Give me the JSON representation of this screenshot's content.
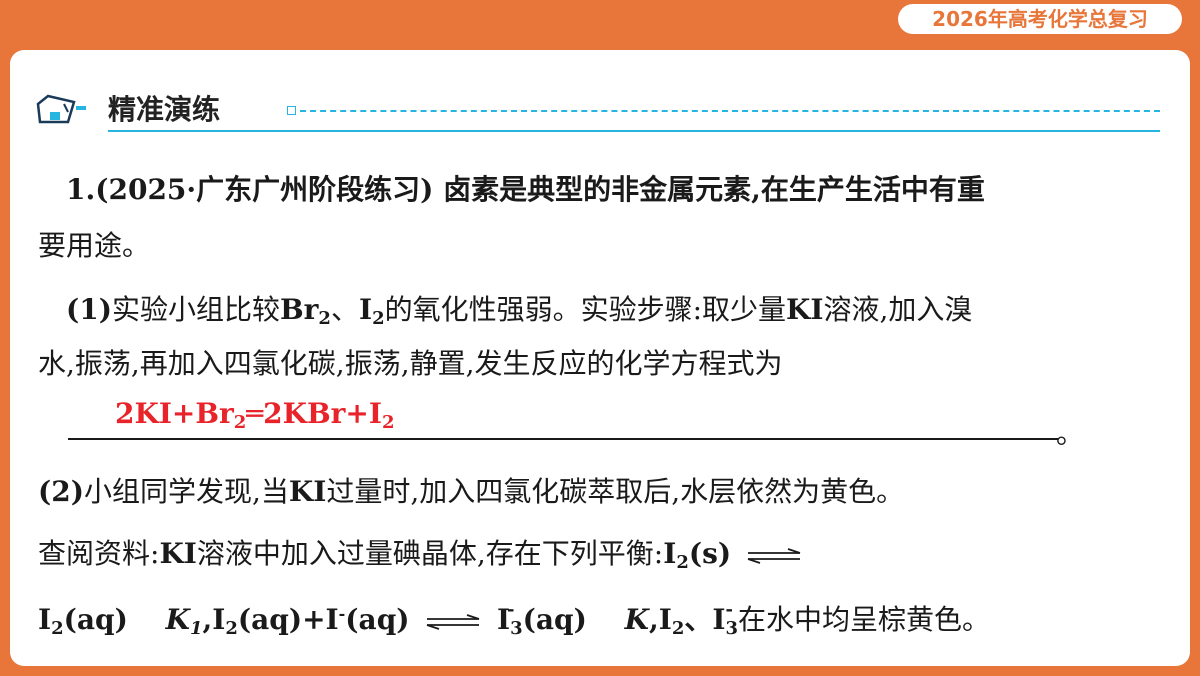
{
  "badge": {
    "text": "2026年高考化学总复习"
  },
  "section": {
    "title": "精准演练",
    "icon": "presentation-board-icon"
  },
  "colors": {
    "background": "#e8763a",
    "accent": "#26b5e0",
    "answer": "#e8232a"
  },
  "question": {
    "intro_line1": "1.(2025·广东广州阶段练习) 卤素是典型的非金属元素,在生产生活中有重",
    "intro_line2": "要用途。",
    "part1_label": "(1)",
    "part1_text_a": "实验小组比较",
    "br": "Br",
    "sub2": "2",
    "dun": "、",
    "i": "I",
    "part1_text_b": "的氧化性强弱。实验步骤:取少量",
    "ki": "KI",
    "part1_text_c": "溶液,加入溴",
    "part1_line2": "水,振荡,再加入四氯化碳,振荡,静置,发生反应的化学方程式为",
    "answer_a": "2KI+Br",
    "answer_b": "═2KBr+I",
    "period": "。",
    "part2_label": "(2)",
    "part2_text": "小组同学发现,当",
    "part2_text_b": "过量时,加入四氯化碳萃取后,水层依然为黄色。",
    "ref_a": "查阅资料:",
    "ref_b": "溶液中加入过量碘晶体,存在下列平衡:",
    "i2s": "(s)",
    "aq": "(aq)",
    "k": "K",
    "k1": "1",
    "comma": ",",
    "eq2_mid": "(aq)+I",
    "minus": "-",
    "three": "3",
    "eq2_end": "(aq)",
    "final_a": "K",
    "final_b": ",I",
    "final_c": "、I",
    "final_d": "在水中均呈棕黄色。"
  }
}
